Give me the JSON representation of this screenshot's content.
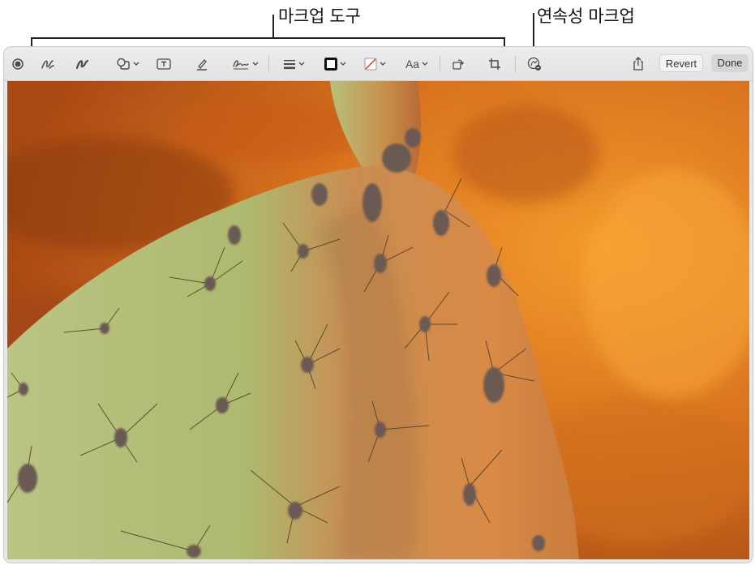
{
  "callouts": {
    "markup_tools": "마크업 도구",
    "continuity_markup": "연속성 마크업"
  },
  "toolbar": {
    "tools": [
      {
        "name": "record",
        "icon": "record-circle-icon"
      },
      {
        "name": "sketch",
        "icon": "sketch-icon"
      },
      {
        "name": "draw",
        "icon": "draw-icon"
      },
      {
        "name": "shapes",
        "icon": "shapes-icon",
        "menu": true
      },
      {
        "name": "text",
        "icon": "text-box-icon"
      },
      {
        "name": "highlight",
        "icon": "highlighter-icon"
      },
      {
        "name": "sign",
        "icon": "signature-icon",
        "menu": true
      },
      {
        "name": "shape-style",
        "icon": "line-weight-icon",
        "menu": true
      },
      {
        "name": "border-color",
        "icon": "border-color-icon",
        "menu": true
      },
      {
        "name": "fill-color",
        "icon": "fill-color-icon",
        "menu": true
      },
      {
        "name": "text-style",
        "icon": "text-style-icon",
        "menu": true
      },
      {
        "name": "rotate",
        "icon": "rotate-icon"
      },
      {
        "name": "crop",
        "icon": "crop-icon"
      },
      {
        "name": "annotate",
        "icon": "continuity-markup-icon"
      },
      {
        "name": "share",
        "icon": "share-icon"
      }
    ],
    "text_style_label": "Aa",
    "revert_label": "Revert",
    "done_label": "Done"
  },
  "colors": {
    "toolbar_bg": "#e6e6e6",
    "icon": "#4a4a4a",
    "background_orange": "#d9731f",
    "cactus_green": "#b4c07a"
  }
}
